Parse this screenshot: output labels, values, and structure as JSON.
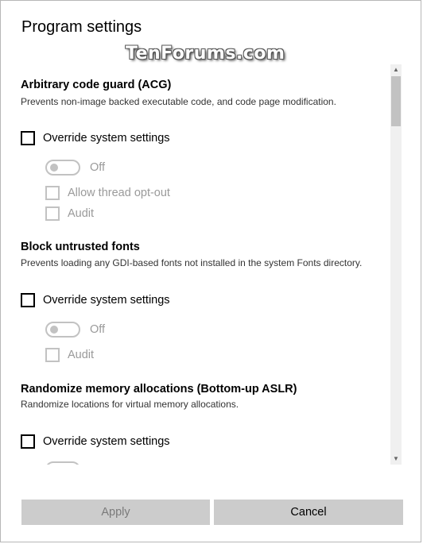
{
  "dialog": {
    "title": "Program settings",
    "watermark": "TenForums.com"
  },
  "sections": [
    {
      "title": "Arbitrary code guard (ACG)",
      "description": "Prevents non-image backed executable code, and code page modification.",
      "override_label": "Override system settings",
      "toggle_label": "Off",
      "options": [
        "Allow thread opt-out",
        "Audit"
      ]
    },
    {
      "title": "Block untrusted fonts",
      "description": "Prevents loading any GDI-based fonts not installed in the system Fonts directory.",
      "override_label": "Override system settings",
      "toggle_label": "Off",
      "options": [
        "Audit"
      ]
    },
    {
      "title": "Randomize memory allocations (Bottom-up ASLR)",
      "description": "Randomize locations for virtual memory allocations.",
      "override_label": "Override system settings"
    }
  ],
  "buttons": {
    "apply": "Apply",
    "cancel": "Cancel"
  },
  "scrollbar": {
    "up_icon": "▲",
    "down_icon": "▼"
  }
}
